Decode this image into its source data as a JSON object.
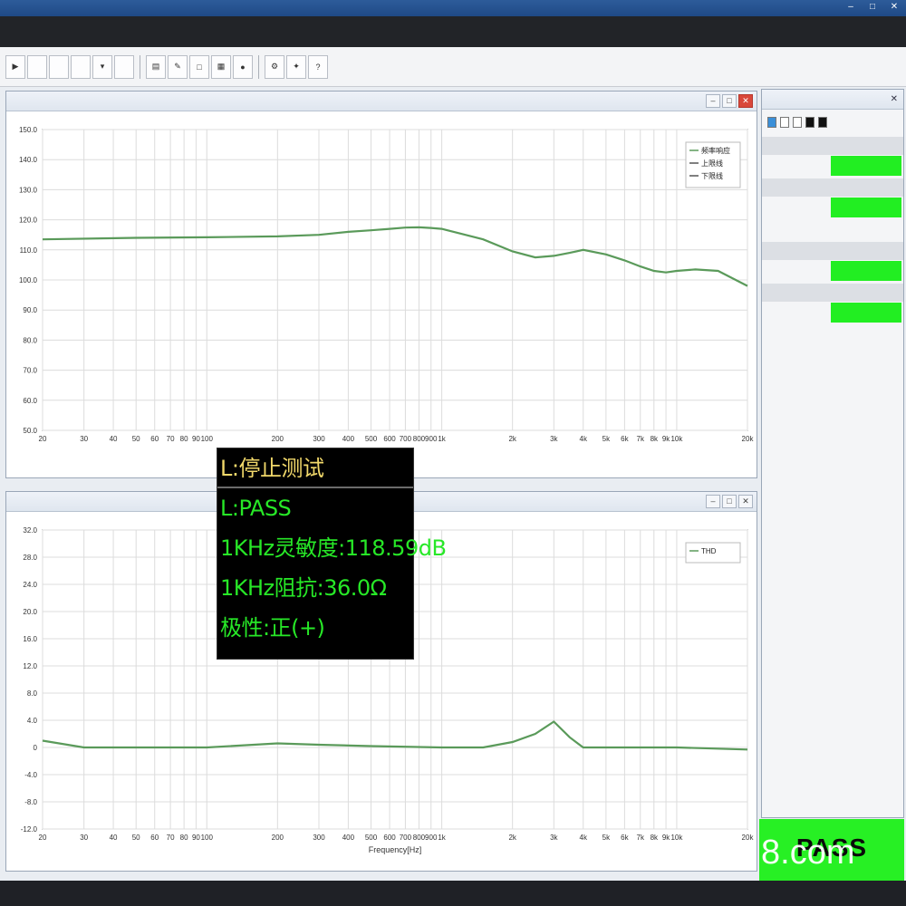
{
  "overlay": {
    "lines": [
      "L:停止测试",
      "L:PASS",
      "1KHz灵敏度:118.59dB",
      "1KHz阻抗:36.0Ω",
      "极性:正(+)"
    ]
  },
  "pass_banner": "PASS",
  "watermark_text": "8.com",
  "colors": {
    "curve": "#5a9a5a",
    "pass_green": "#27f024",
    "overlay_green": "#27e827",
    "overlay_yellow": "#f1d86a"
  },
  "chart_data": [
    {
      "type": "line",
      "x_scale": "log",
      "xlim": [
        20,
        20000
      ],
      "x_ticks": [
        "20",
        "30",
        "40",
        "50",
        "60",
        "70",
        "80",
        "90",
        "100",
        "200",
        "300",
        "400",
        "500",
        "600",
        "700",
        "800",
        "900",
        "1k",
        "2k",
        "3k",
        "4k",
        "5k",
        "6k",
        "7k",
        "8k",
        "9k",
        "10k",
        "20k"
      ],
      "y_ticks": [
        "150.0",
        "140.0",
        "130.0",
        "120.0",
        "110.0",
        "100.0",
        "90.0",
        "80.0",
        "70.0",
        "60.0",
        "50.0"
      ],
      "ylim": [
        50,
        150
      ],
      "grid": true,
      "legend": [
        "频率响应",
        "上限线",
        "下限线"
      ],
      "legend_position": "top-right",
      "series": [
        {
          "name": "频率响应",
          "x": [
            20,
            50,
            100,
            200,
            300,
            400,
            500,
            600,
            700,
            800,
            900,
            1000,
            1500,
            2000,
            2500,
            3000,
            3500,
            4000,
            5000,
            6000,
            7000,
            8000,
            9000,
            10000,
            12000,
            15000,
            20000
          ],
          "y": [
            113.5,
            114,
            114.2,
            114.5,
            115,
            116,
            116.5,
            117,
            117.4,
            117.5,
            117.3,
            117,
            113.5,
            109.5,
            107.5,
            108,
            109,
            110,
            108.5,
            106.5,
            104.5,
            103,
            102.5,
            103,
            103.5,
            103,
            98
          ]
        }
      ]
    },
    {
      "type": "line",
      "x_scale": "log",
      "xlim": [
        20,
        20000
      ],
      "x_ticks": [
        "20",
        "30",
        "40",
        "50",
        "60",
        "70",
        "80",
        "90",
        "100",
        "200",
        "300",
        "400",
        "500",
        "600",
        "700",
        "800",
        "900",
        "1k",
        "2k",
        "3k",
        "4k",
        "5k",
        "6k",
        "7k",
        "8k",
        "9k",
        "10k",
        "20k"
      ],
      "y_ticks": [
        "32.0",
        "28.0",
        "24.0",
        "20.0",
        "16.0",
        "12.0",
        "8.0",
        "4.0",
        "0",
        "-4.0",
        "-8.0",
        "-12.0"
      ],
      "ylim": [
        -12,
        32
      ],
      "grid": true,
      "xlabel": "Frequency[Hz]",
      "legend": [
        "THD"
      ],
      "legend_position": "top-right",
      "series": [
        {
          "name": "THD",
          "x": [
            20,
            30,
            50,
            100,
            200,
            300,
            500,
            1000,
            1500,
            2000,
            2500,
            3000,
            3500,
            4000,
            5000,
            10000,
            20000
          ],
          "y": [
            1.0,
            0.0,
            0.0,
            0.0,
            0.6,
            0.4,
            0.2,
            0.0,
            0.0,
            0.8,
            2.0,
            3.8,
            1.5,
            0.0,
            0.0,
            0.0,
            -0.3
          ]
        }
      ]
    }
  ]
}
